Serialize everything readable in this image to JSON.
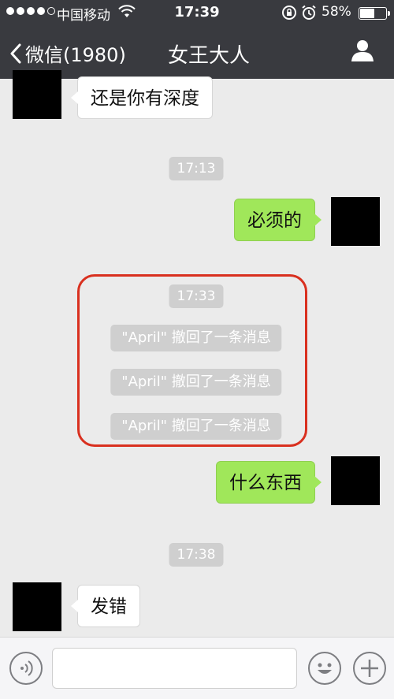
{
  "status": {
    "carrier": "中国移动",
    "time": "17:39",
    "battery_percent": "58%",
    "battery_level": 0.58,
    "signal_icons": [
      "signal-dot-icon",
      "wifi-icon",
      "orientation-lock-icon",
      "alarm-icon",
      "battery-icon"
    ]
  },
  "nav": {
    "back_label": "微信(1980)",
    "title": "女王大人"
  },
  "messages": [
    {
      "side": "left",
      "text": "还是你有深度"
    },
    {
      "time": "17:13"
    },
    {
      "side": "right",
      "text": "必须的"
    },
    {
      "time": "17:33"
    },
    {
      "system": "\"April\" 撤回了一条消息"
    },
    {
      "system": "\"April\" 撤回了一条消息"
    },
    {
      "system": "\"April\" 撤回了一条消息"
    },
    {
      "side": "right",
      "text": "什么东西"
    },
    {
      "time": "17:38"
    },
    {
      "side": "left",
      "text": "发错"
    }
  ],
  "input": {
    "value": "",
    "placeholder": ""
  },
  "colors": {
    "navbar": "#393a3f",
    "background": "#ebebeb",
    "outgoing_bubble": "#a0e75a",
    "incoming_bubble": "#ffffff",
    "highlight_ring": "#d9301f"
  }
}
